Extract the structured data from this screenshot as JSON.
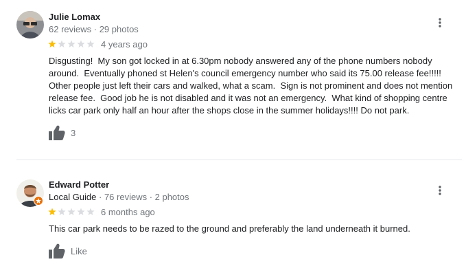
{
  "reviews": [
    {
      "name": "Julie Lomax",
      "local_guide": "",
      "meta": "62 reviews · 29 photos",
      "rating": 1,
      "max_rating": 5,
      "time": "4 years ago",
      "text": "Disgusting!  My son got locked in at 6.30pm nobody answered any of the phone numbers nobody\naround.  Eventually phoned st Helen's council emergency number who said its 75.00 release fee!!!!!\nOther people just left their cars and walked, what a scam.  Sign is not prominent and does not mention\nrelease fee.  Good job he is not disabled and it was not an emergency.  What kind of shopping centre\nlicks car park only half an hour after the shops close in the summer holidays!!!! Do not park.",
      "like_label": "3"
    },
    {
      "name": "Edward Potter",
      "local_guide": "Local Guide",
      "meta": " · 76 reviews · 2 photos",
      "rating": 1,
      "max_rating": 5,
      "time": "6 months ago",
      "text": "This car park needs to be razed to the ground and preferably the land underneath it burned.",
      "like_label": "Like"
    }
  ],
  "colors": {
    "star_filled": "#fbbc04",
    "star_empty": "#dadce0",
    "icon": "#5f6368",
    "badge": "#e8710a"
  }
}
